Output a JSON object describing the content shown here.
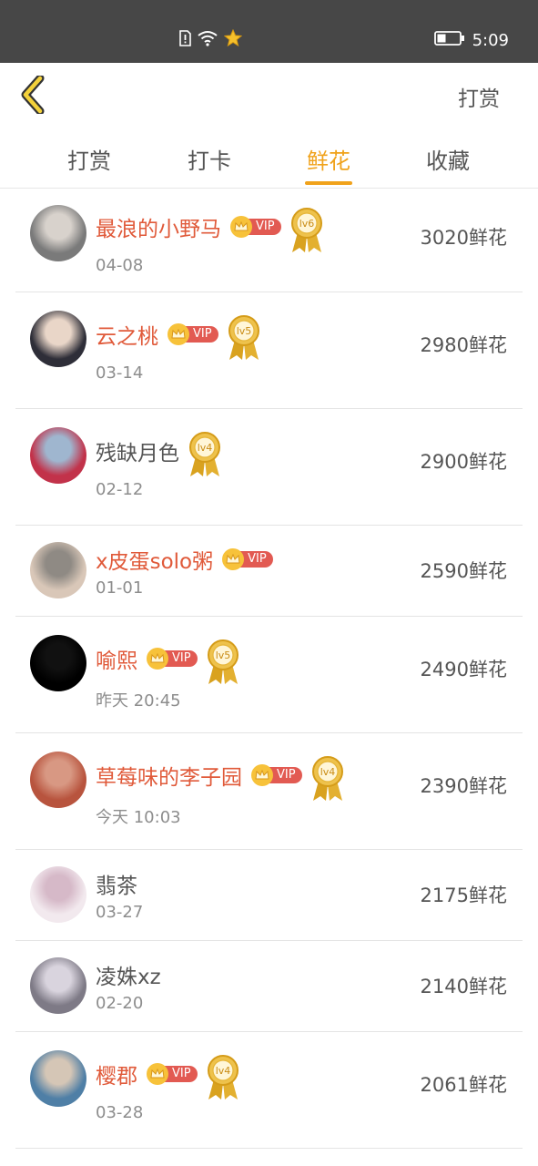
{
  "status_bar": {
    "time": "5:09",
    "icons": [
      "sim-alert-icon",
      "wifi-icon",
      "star-notification-icon",
      "battery-icon"
    ]
  },
  "header": {
    "back_icon": "chevron-left-icon",
    "action_label": "打赏"
  },
  "tabs": [
    {
      "label": "打赏",
      "active": false
    },
    {
      "label": "打卡",
      "active": false
    },
    {
      "label": "鲜花",
      "active": true
    },
    {
      "label": "收藏",
      "active": false
    }
  ],
  "colors": {
    "accent": "#f0a21b",
    "vip_name": "#e05a3a",
    "vip_pill": "#e25a52",
    "status_bar": "#474747"
  },
  "list": [
    {
      "name": "最浪的小野马",
      "vip": true,
      "vip_label": "VIP",
      "level": "lv6",
      "date": "04-08",
      "flowers": "3020鲜花"
    },
    {
      "name": "云之桃",
      "vip": true,
      "vip_label": "VIP",
      "level": "lv5",
      "date": "03-14",
      "flowers": "2980鲜花"
    },
    {
      "name": "残缺月色",
      "vip": false,
      "level": "lv4",
      "date": "02-12",
      "flowers": "2900鲜花"
    },
    {
      "name": "x皮蛋solo粥",
      "vip": true,
      "vip_label": "VIP",
      "level": "",
      "date": "01-01",
      "flowers": "2590鲜花"
    },
    {
      "name": "喻熙",
      "vip": true,
      "vip_label": "VIP",
      "level": "lv5",
      "date": "昨天 20:45",
      "flowers": "2490鲜花"
    },
    {
      "name": "草莓味的李子园",
      "vip": true,
      "vip_label": "VIP",
      "level": "lv4",
      "date": "今天 10:03",
      "flowers": "2390鲜花"
    },
    {
      "name": "翡茶",
      "vip": false,
      "level": "",
      "date": "03-27",
      "flowers": "2175鲜花"
    },
    {
      "name": "凌姝xz",
      "vip": false,
      "level": "",
      "date": "02-20",
      "flowers": "2140鲜花"
    },
    {
      "name": "樱郡",
      "vip": true,
      "vip_label": "VIP",
      "level": "lv4",
      "date": "03-28",
      "flowers": "2061鲜花"
    }
  ]
}
